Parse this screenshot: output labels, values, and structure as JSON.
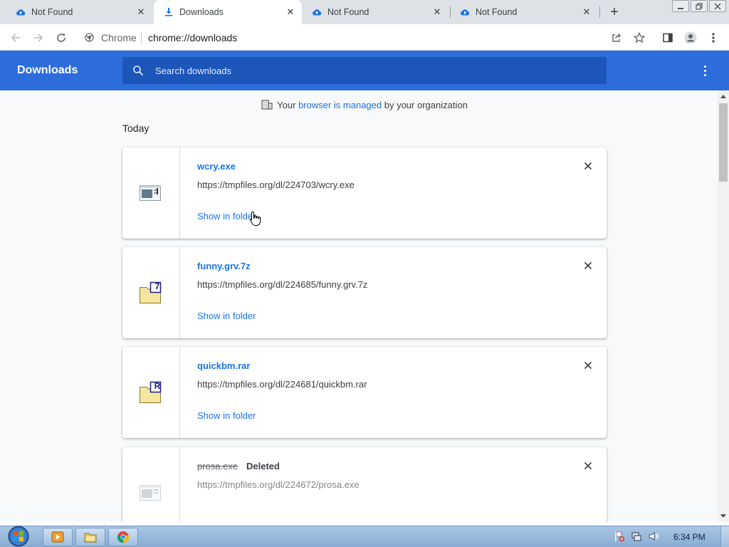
{
  "tabs": [
    {
      "label": "Not Found",
      "icon": "cloud-upload-icon",
      "active": false
    },
    {
      "label": "Downloads",
      "icon": "download-icon",
      "active": true
    },
    {
      "label": "Not Found",
      "icon": "cloud-upload-icon",
      "active": false
    },
    {
      "label": "Not Found",
      "icon": "cloud-upload-icon",
      "active": false
    }
  ],
  "toolbar": {
    "chip": "Chrome",
    "url": "chrome://downloads"
  },
  "header": {
    "title": "Downloads",
    "search_placeholder": "Search downloads"
  },
  "managed": {
    "prefix": "Your ",
    "link": "browser is managed",
    "suffix": " by your organization"
  },
  "section_label": "Today",
  "downloads": [
    {
      "name": "wcry.exe",
      "url": "https://tmpfiles.org/dl/224703/wcry.exe",
      "action": "Show in folder",
      "status": "",
      "icon": "exe-file-icon"
    },
    {
      "name": "funny.grv.7z",
      "url": "https://tmpfiles.org/dl/224685/funny.grv.7z",
      "action": "Show in folder",
      "status": "",
      "icon": "7z-archive-icon",
      "badge": "7"
    },
    {
      "name": "quickbm.rar",
      "url": "https://tmpfiles.org/dl/224681/quickbm.rar",
      "action": "Show in folder",
      "status": "",
      "icon": "rar-archive-icon",
      "badge": "R"
    },
    {
      "name": "prosa.exe",
      "url": "https://tmpfiles.org/dl/224672/prosa.exe",
      "action": "",
      "status": "Deleted",
      "icon": "exe-file-icon"
    }
  ],
  "taskbar": {
    "clock": "6:34 PM"
  },
  "colors": {
    "header_blue": "#2d6cdb",
    "link_blue": "#1a73e8"
  }
}
